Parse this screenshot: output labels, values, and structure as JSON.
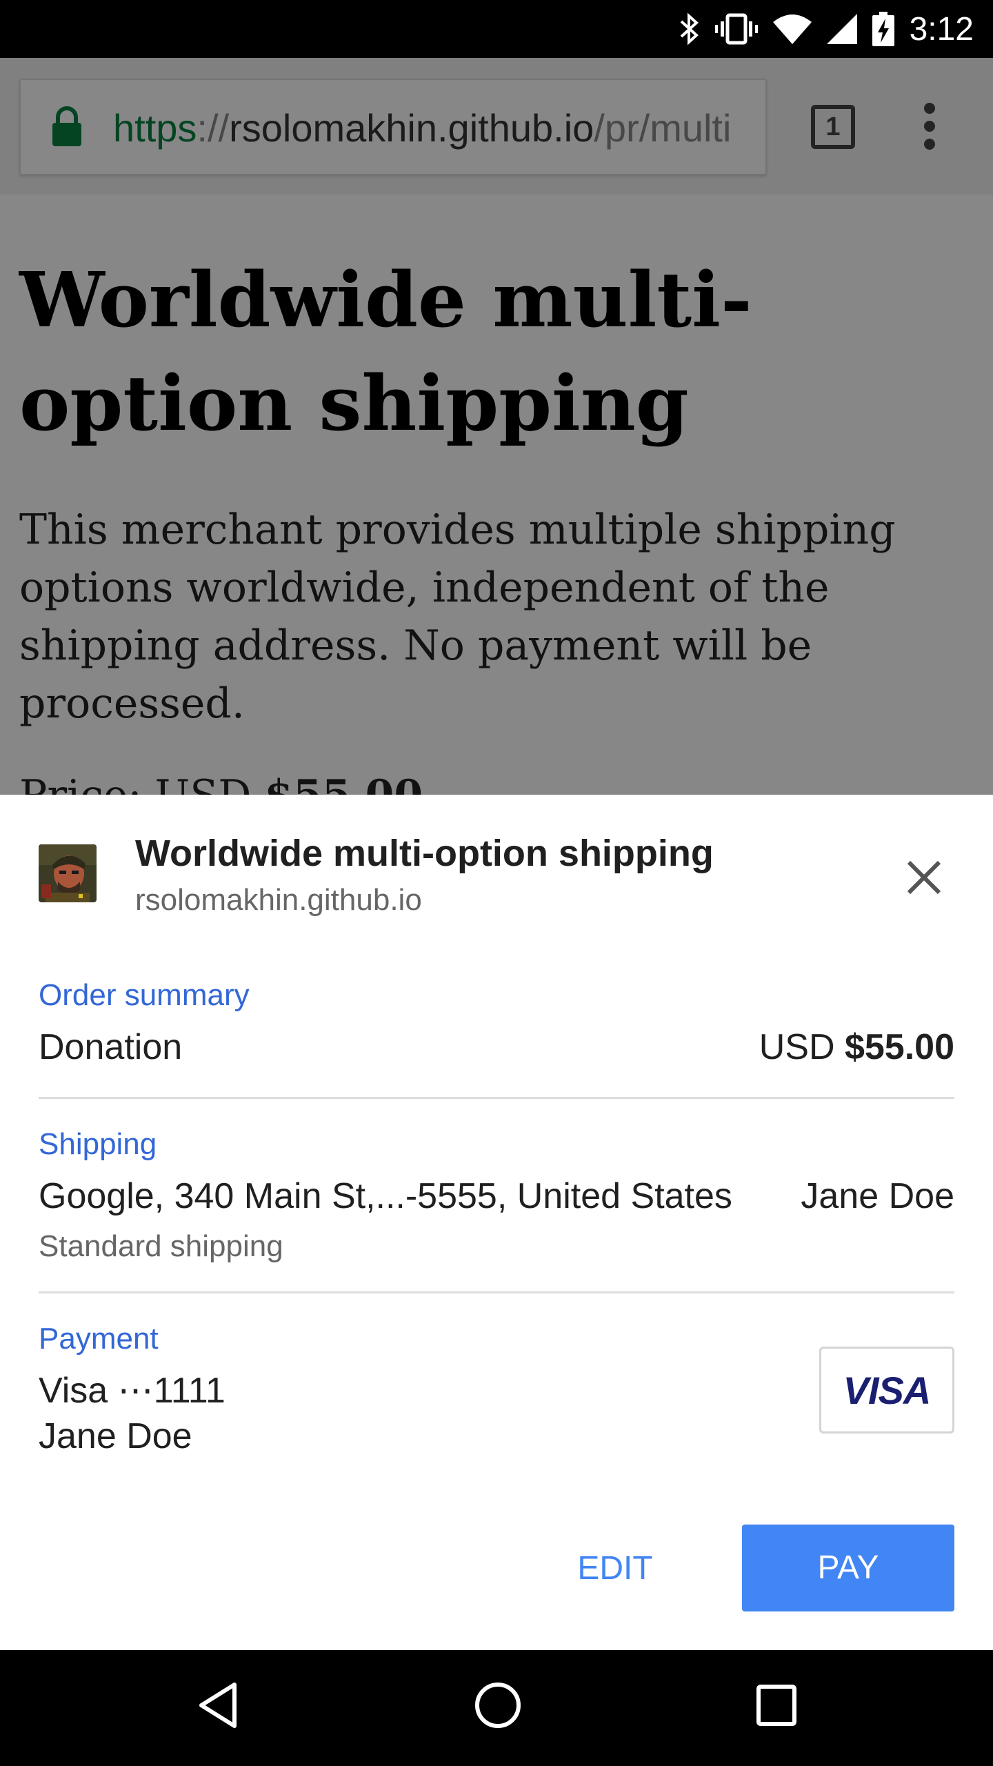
{
  "status_bar": {
    "time": "3:12",
    "icons": [
      "bluetooth-icon",
      "vibrate-icon",
      "wifi-icon",
      "signal-icon",
      "battery-charging-icon"
    ]
  },
  "toolbar": {
    "url_scheme": "https",
    "url_separator": "://",
    "url_host": "rsolomakhin.github.io",
    "url_path": "/pr/multi",
    "tab_count": "1"
  },
  "page": {
    "title": "Worldwide multi-option shipping",
    "description": "This merchant provides multiple shipping options worldwide, independent of the shipping address. No payment will be processed.",
    "price_prefix": "Price: USD ",
    "price_value": "$55.00"
  },
  "sheet": {
    "title": "Worldwide multi-option shipping",
    "origin": "rsolomakhin.github.io",
    "order_summary": {
      "label": "Order summary",
      "item": "Donation",
      "currency": "USD",
      "amount": "$55.00"
    },
    "shipping": {
      "label": "Shipping",
      "address": "Google, 340 Main St,...-5555, United States",
      "name": "Jane Doe",
      "option": "Standard shipping"
    },
    "payment": {
      "label": "Payment",
      "card": "Visa ⋯1111",
      "holder": "Jane Doe",
      "card_brand": "VISA"
    },
    "buttons": {
      "edit": "EDIT",
      "pay": "PAY"
    }
  },
  "colors": {
    "accent": "#4285f4",
    "section_label": "#3367d6",
    "secure_green": "#0b8043",
    "visa_blue": "#1a1f71"
  }
}
